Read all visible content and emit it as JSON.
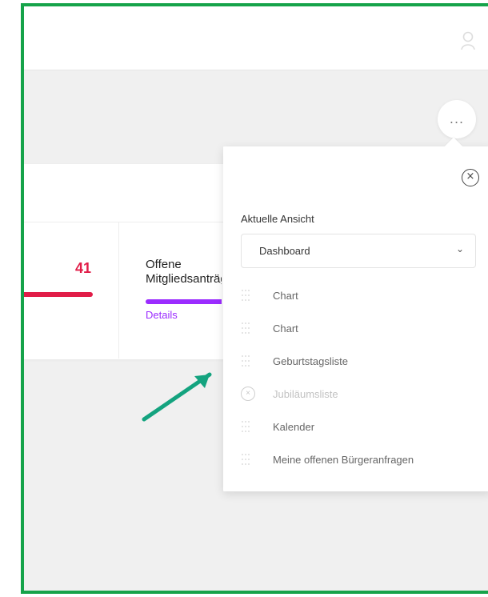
{
  "dashboard": {
    "stat_value": "41",
    "stat_title": "Offene Mitgliedsanträge",
    "details_label": "Details",
    "colors": {
      "red": "#e11d48",
      "purple": "#9b2cff",
      "border": "#16a34a"
    }
  },
  "menu": {
    "more_label": "...",
    "close_symbol": "×",
    "current_view_label": "Aktuelle Ansicht",
    "selected_view": "Dashboard",
    "chevron": "⌄",
    "items": [
      {
        "label": "Chart",
        "state": "enabled",
        "icon": "drag-handle-icon"
      },
      {
        "label": "Chart",
        "state": "enabled",
        "icon": "drag-handle-icon"
      },
      {
        "label": "Geburtstagsliste",
        "state": "enabled",
        "icon": "drag-handle-icon"
      },
      {
        "label": "Jubiläumsliste",
        "state": "disabled",
        "icon": "circle-x-icon"
      },
      {
        "label": "Kalender",
        "state": "enabled",
        "icon": "drag-handle-icon"
      },
      {
        "label": "Meine offenen Bürgeranfragen",
        "state": "enabled",
        "icon": "drag-handle-icon"
      }
    ]
  },
  "icons": {
    "user": "user-icon",
    "more": "ellipsis-icon",
    "close": "close-circle-icon",
    "arrow": "arrow-up-right-icon"
  }
}
